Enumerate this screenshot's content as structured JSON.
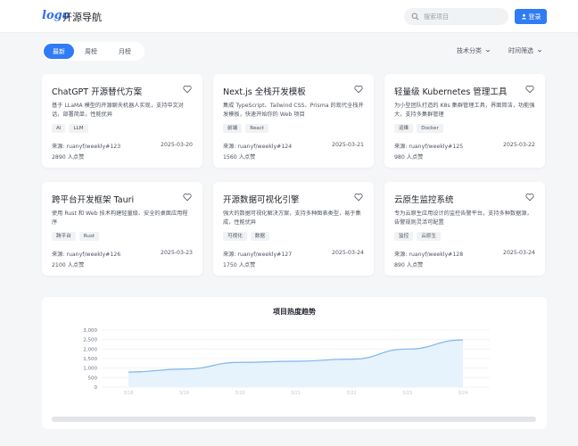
{
  "header": {
    "logo": "logo",
    "site_name": "开源导航",
    "search_placeholder": "搜索项目",
    "login_label": "登录"
  },
  "tabs": [
    {
      "label": "最新",
      "active": true
    },
    {
      "label": "周榜",
      "active": false
    },
    {
      "label": "月榜",
      "active": false
    }
  ],
  "filters": {
    "category": "技术分类",
    "time": "时间筛选"
  },
  "cards": [
    {
      "title": "ChatGPT 开源替代方案",
      "desc": "基于 LLaMA 模型的开源聊天机器人实现，支持中文对话，部署简单，性能优异",
      "tags": [
        "AI",
        "LLM"
      ],
      "source": "来源: ruanyf/weekly#123",
      "date": "2025-03-20",
      "likes": "2890 人点赞"
    },
    {
      "title": "Next.js 全栈开发模板",
      "desc": "集成 TypeScript、Tailwind CSS、Prisma 的现代全栈开发模板，快速开始你的 Web 项目",
      "tags": [
        "前端",
        "React"
      ],
      "source": "来源: ruanyf/weekly#124",
      "date": "2025-03-21",
      "likes": "1560 人点赞"
    },
    {
      "title": "轻量级 Kubernetes 管理工具",
      "desc": "为小型团队打造的 K8s 集群管理工具，界面简洁，功能强大，支持多集群管理",
      "tags": [
        "运维",
        "Docker"
      ],
      "source": "来源: ruanyf/weekly#125",
      "date": "2025-03-22",
      "likes": "980 人点赞"
    },
    {
      "title": "跨平台开发框架 Tauri",
      "desc": "使用 Rust 和 Web 技术构建轻量级、安全的桌面应用程序",
      "tags": [
        "跨平台",
        "Rust"
      ],
      "source": "来源: ruanyf/weekly#126",
      "date": "2025-03-23",
      "likes": "2100 人点赞"
    },
    {
      "title": "开源数据可视化引擎",
      "desc": "强大的数据可视化解决方案，支持多种图表类型，易于集成，性能优异",
      "tags": [
        "可视化",
        "数据"
      ],
      "source": "来源: ruanyf/weekly#127",
      "date": "2025-03-24",
      "likes": "1750 人点赞"
    },
    {
      "title": "云原生监控系统",
      "desc": "专为云原生应用设计的监控告警平台，支持多种数据源，告警规则灵活可配置",
      "tags": [
        "监控",
        "云原生"
      ],
      "source": "来源: ruanyf/weekly#128",
      "date": "2025-03-24",
      "likes": "890 人点赞"
    }
  ],
  "chart_data": {
    "type": "area",
    "title": "项目热度趋势",
    "x": [
      "3/18",
      "3/19",
      "3/20",
      "3/21",
      "3/22",
      "3/23",
      "3/24"
    ],
    "values": [
      790,
      950,
      1300,
      1360,
      1470,
      2000,
      2480
    ],
    "ylim": [
      0,
      3000
    ],
    "yticks": [
      "0",
      "500",
      "1,000",
      "1,500",
      "2,000",
      "2,500",
      "3,000"
    ],
    "grid": true,
    "line_color": "#7fb6ea",
    "fill_color": "#e6f2fc"
  }
}
